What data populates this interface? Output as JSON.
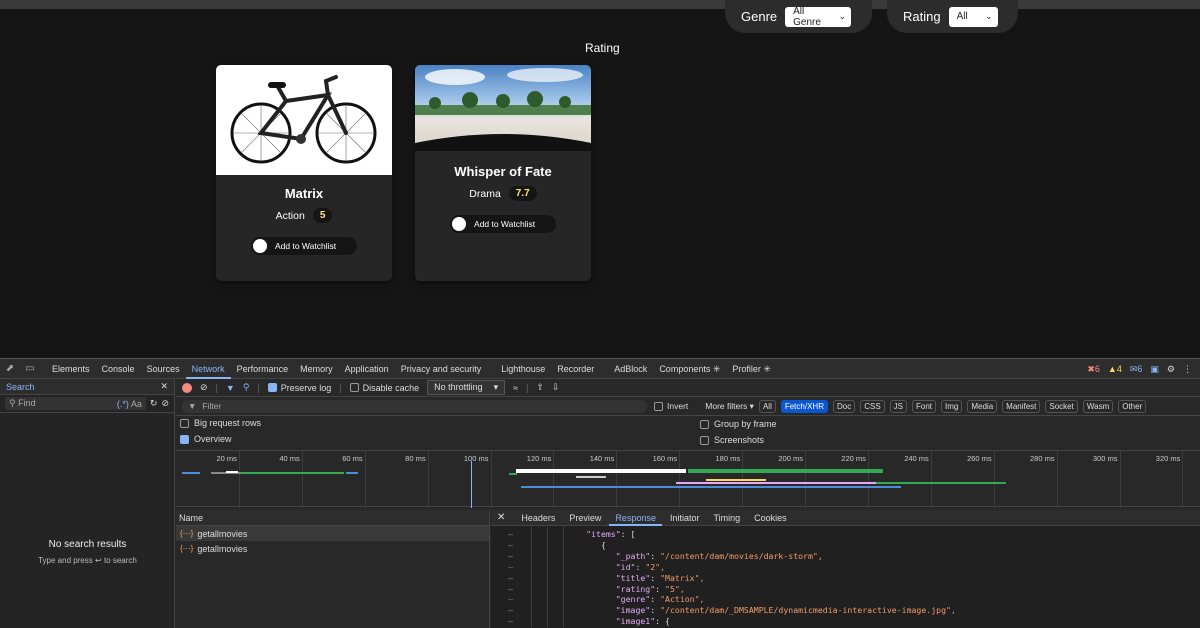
{
  "page": {
    "filters": {
      "genre_label": "Genre",
      "genre_value": "All Genre",
      "rating_label": "Rating",
      "rating_value": "All"
    },
    "heading": "Rating",
    "cards": [
      {
        "title": "Matrix",
        "genre": "Action",
        "rating": "5",
        "watchlist_label": "Add to Watchlist"
      },
      {
        "title": "Whisper of Fate",
        "genre": "Drama",
        "rating": "7.7",
        "watchlist_label": "Add to Watchlist"
      }
    ]
  },
  "devtools": {
    "tabs": [
      "Elements",
      "Console",
      "Sources",
      "Network",
      "Performance",
      "Memory",
      "Application",
      "Privacy and security",
      "Lighthouse",
      "Recorder",
      "AdBlock",
      "Components ✳",
      "Profiler ✳"
    ],
    "active_tab": "Network",
    "counts": {
      "errors": "6",
      "warnings": "4",
      "messages": "6"
    },
    "search_panel": {
      "title": "Search",
      "placeholder": "Find",
      "regex_label": "(.*)",
      "case_label": "Aa",
      "empty_title": "No search results",
      "empty_hint": "Type and press ↩ to search"
    },
    "toolbar": {
      "preserve_log": "Preserve log",
      "disable_cache": "Disable cache",
      "throttling": "No throttling"
    },
    "filter_bar": {
      "placeholder": "Filter",
      "invert": "Invert",
      "more_filters": "More filters",
      "chips": [
        "All",
        "Fetch/XHR",
        "Doc",
        "CSS",
        "JS",
        "Font",
        "Img",
        "Media",
        "Manifest",
        "Socket",
        "Wasm",
        "Other"
      ],
      "active_chip": "Fetch/XHR"
    },
    "options": {
      "big_request_rows": "Big request rows",
      "group_by_frame": "Group by frame",
      "overview": "Overview",
      "screenshots": "Screenshots"
    },
    "timeline_ticks": [
      "20 ms",
      "40 ms",
      "60 ms",
      "80 ms",
      "100 ms",
      "120 ms",
      "140 ms",
      "160 ms",
      "180 ms",
      "200 ms",
      "220 ms",
      "240 ms",
      "260 ms",
      "280 ms",
      "300 ms",
      "320 ms"
    ],
    "requests": {
      "header": "Name",
      "rows": [
        "getallmovies",
        "getallmovies"
      ]
    },
    "detail_tabs": [
      "Headers",
      "Preview",
      "Response",
      "Initiator",
      "Timing",
      "Cookies"
    ],
    "active_detail_tab": "Response",
    "response_lines": [
      {
        "indent": 0,
        "key": "\"items\"",
        "value": " ["
      },
      {
        "indent": 1,
        "key": "",
        "value": "{"
      },
      {
        "indent": 2,
        "key": "\"_path\"",
        "value": "\"/content/dam/movies/dark-storm\","
      },
      {
        "indent": 2,
        "key": "\"id\"",
        "value": "\"2\","
      },
      {
        "indent": 2,
        "key": "\"title\"",
        "value": "\"Matrix\","
      },
      {
        "indent": 2,
        "key": "\"rating\"",
        "value": "\"5\","
      },
      {
        "indent": 2,
        "key": "\"genre\"",
        "value": "\"Action\","
      },
      {
        "indent": 2,
        "key": "\"image\"",
        "value": "\"/content/dam/_DMSAMPLE/dynamicmedia-interactive-image.jpg\","
      },
      {
        "indent": 2,
        "key": "\"image1\"",
        "value": " {"
      }
    ]
  },
  "colors": {
    "accent": "#8ab4f8",
    "rating_badge": "#ffe082",
    "json_key": "#e8a8f8",
    "json_string": "#f29b6b"
  }
}
